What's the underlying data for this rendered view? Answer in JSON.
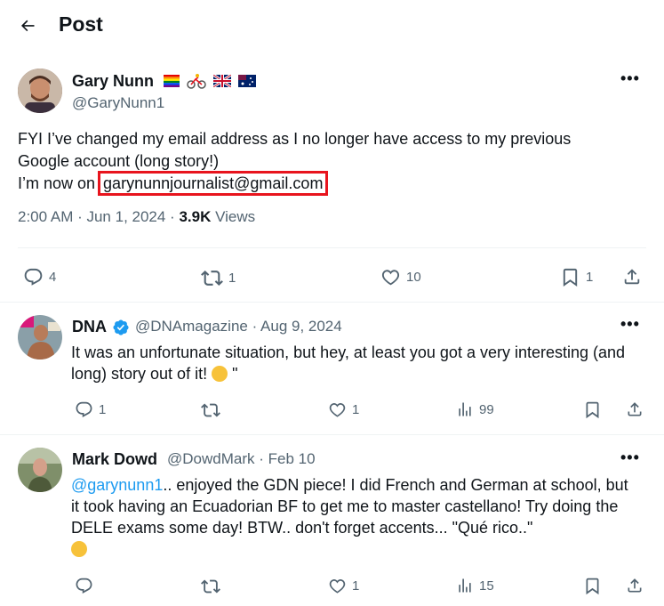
{
  "header": {
    "title": "Post"
  },
  "main_post": {
    "author_name": "Gary Nunn",
    "author_handle": "@GaryNunn1",
    "text_line1": "FYI I’ve changed my email address as I no longer have access to my previous",
    "text_line2": "Google account (long story!)",
    "text_line3_prefix": "I’m now on ",
    "email": "garynunnjournalist@gmail.com",
    "time": "2:00 AM · Jun 1, 2024 · ",
    "views_count": "3.9K",
    "views_label": " Views",
    "replies": "4",
    "reposts": "1",
    "likes": "10",
    "bookmarks": "1"
  },
  "replies": [
    {
      "name": "DNA",
      "handle_date": "@DNAmagazine · Aug 9, 2024",
      "text": "It was an unfortunate situation, but hey, at least you got a very interesting (and long) story out of it! ",
      "text_suffix": " \"",
      "replies": "1",
      "reposts": "",
      "likes": "1",
      "views": "99"
    },
    {
      "name": "Mark Dowd",
      "handle_date": "@DowdMark · Feb 10",
      "mention": "@garynunn1",
      "text": ".. enjoyed the GDN piece! I did French and German at school, but it took having an Ecuadorian BF to get me to master castellano! Try doing the DELE exams some day! BTW.. don't forget accents... \"Qué rico..\"",
      "replies": "",
      "reposts": "",
      "likes": "1",
      "views": "15"
    }
  ],
  "colors": {
    "accent": "#1d9bf0",
    "verified": "#1d9bf0",
    "highlight": "#e8141d",
    "secondary_text": "#536471"
  }
}
